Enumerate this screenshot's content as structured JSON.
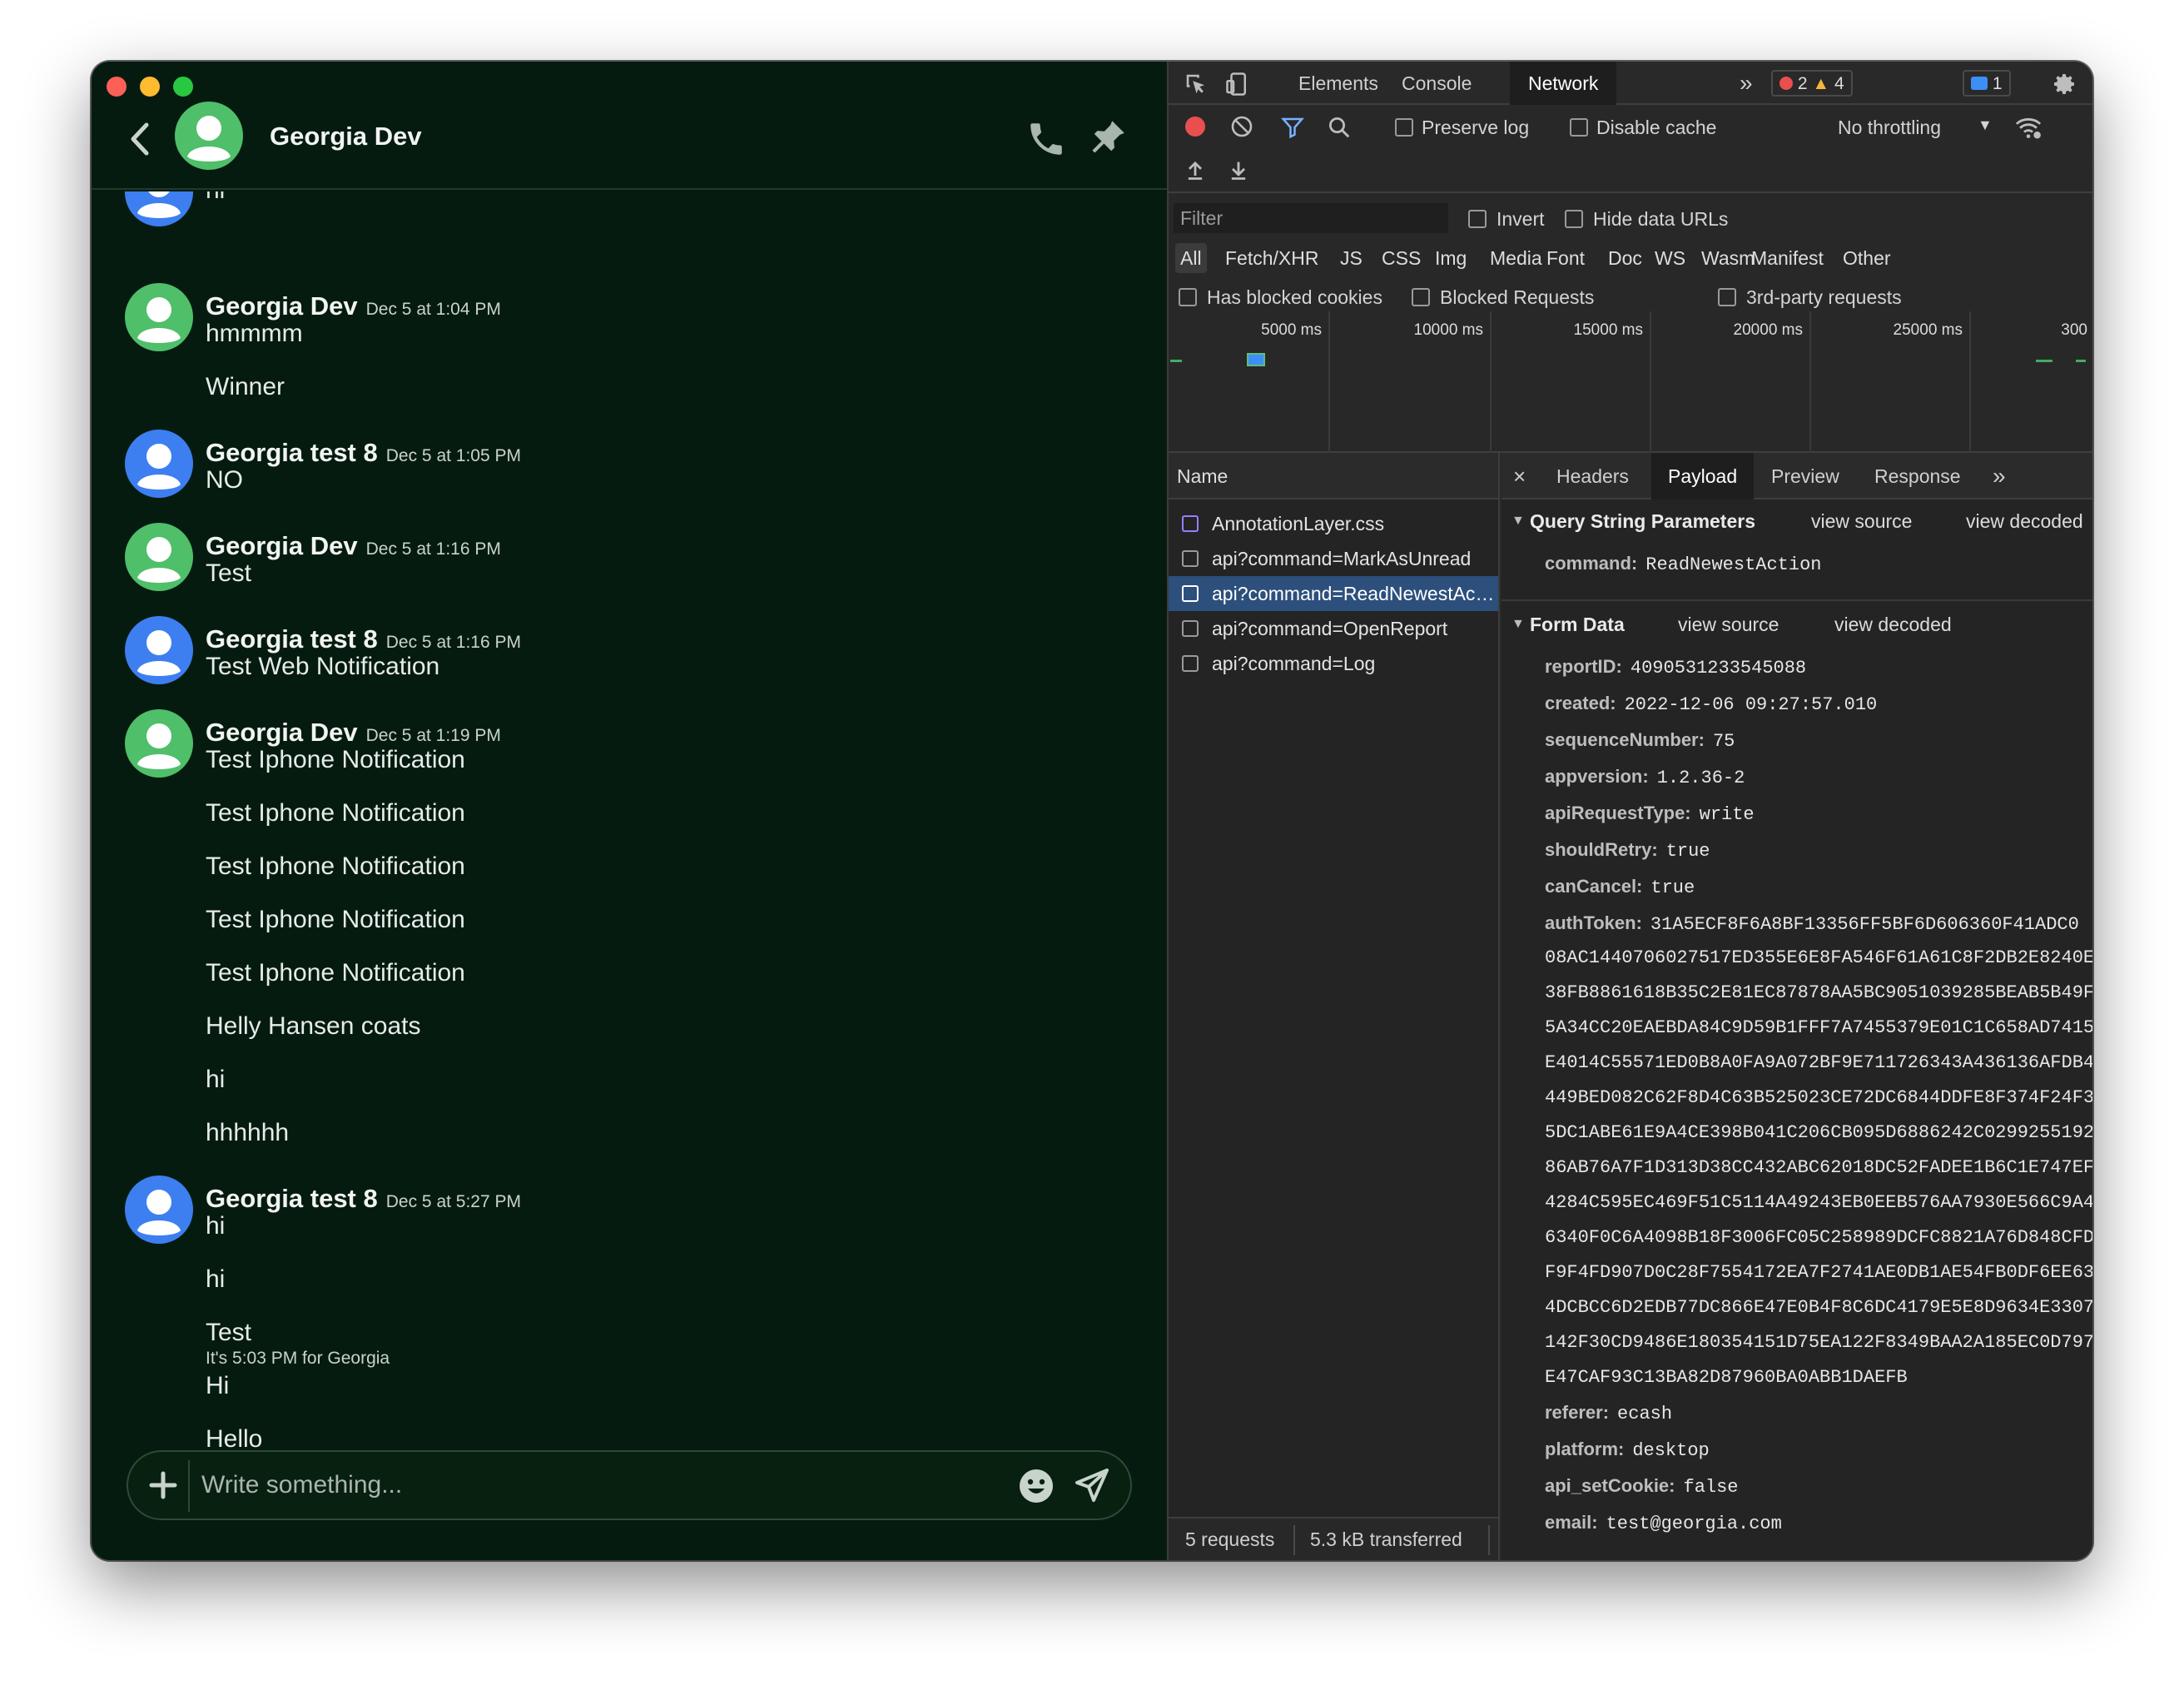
{
  "chat": {
    "contact_name": "Georgia Dev",
    "cut_text": "hi",
    "groups": [
      {
        "author": "Georgia Dev",
        "time": "Dec 5 at 1:04 PM",
        "color": "#4fbf6a",
        "lines": [
          "hmmmm",
          "Winner"
        ]
      },
      {
        "author": "Georgia test 8",
        "time": "Dec 5 at 1:05 PM",
        "color": "#3d7ff0",
        "lines": [
          "NO"
        ]
      },
      {
        "author": "Georgia Dev",
        "time": "Dec 5 at 1:16 PM",
        "color": "#4fbf6a",
        "lines": [
          "Test"
        ]
      },
      {
        "author": "Georgia test 8",
        "time": "Dec 5 at 1:16 PM",
        "color": "#3d7ff0",
        "lines": [
          "Test Web Notification"
        ]
      },
      {
        "author": "Georgia Dev",
        "time": "Dec 5 at 1:19 PM",
        "color": "#4fbf6a",
        "lines": [
          "Test Iphone Notification",
          "Test Iphone Notification",
          "Test Iphone Notification",
          "Test Iphone Notification",
          "Test Iphone Notification",
          "Helly Hansen coats",
          "hi",
          "hhhhhh"
        ]
      },
      {
        "author": "Georgia test 8",
        "time": "Dec 5 at 5:27 PM",
        "color": "#3d7ff0",
        "lines": [
          "hi",
          "hi",
          "Test",
          "Hi",
          "Hello"
        ]
      }
    ],
    "status_line": "It's 5:03 PM for Georgia",
    "composer_placeholder": "Write something..."
  },
  "devtools": {
    "tabs": {
      "elements": "Elements",
      "console": "Console",
      "network": "Network"
    },
    "badges": {
      "errors": "2",
      "warnings": "4",
      "messages": "1"
    },
    "toolbar": {
      "preserve_log": "Preserve log",
      "disable_cache": "Disable cache",
      "throttling": "No throttling"
    },
    "filter": {
      "placeholder": "Filter",
      "invert": "Invert",
      "hide_data_urls": "Hide data URLs",
      "types": [
        "All",
        "Fetch/XHR",
        "JS",
        "CSS",
        "Img",
        "Media",
        "Font",
        "Doc",
        "WS",
        "Wasm",
        "Manifest",
        "Other"
      ],
      "has_blocked_cookies": "Has blocked cookies",
      "blocked_requests": "Blocked Requests",
      "third_party": "3rd-party requests"
    },
    "timeline_labels": [
      "5000 ms",
      "10000 ms",
      "15000 ms",
      "20000 ms",
      "25000 ms",
      "300"
    ],
    "list": {
      "header": "Name",
      "requests": [
        {
          "name": "AnnotationLayer.css",
          "selected": false
        },
        {
          "name": "api?command=MarkAsUnread",
          "selected": false
        },
        {
          "name": "api?command=ReadNewestAction",
          "selected": true
        },
        {
          "name": "api?command=OpenReport",
          "selected": false
        },
        {
          "name": "api?command=Log",
          "selected": false
        }
      ],
      "summary_requests": "5 requests",
      "summary_transferred": "5.3 kB transferred"
    },
    "detail": {
      "tabs": [
        "Headers",
        "Payload",
        "Preview",
        "Response"
      ],
      "active_tab": "Payload",
      "query_section": {
        "title": "Query String Parameters",
        "view_source": "view source",
        "view_decoded": "view decoded",
        "params": [
          {
            "key": "command:",
            "value": "ReadNewestAction"
          }
        ]
      },
      "form_section": {
        "title": "Form Data",
        "view_source": "view source",
        "view_decoded": "view decoded",
        "fields_before": [
          {
            "key": "reportID:",
            "value": "4090531233545088"
          },
          {
            "key": "created:",
            "value": "2022-12-06 09:27:57.010"
          },
          {
            "key": "sequenceNumber:",
            "value": "75"
          },
          {
            "key": "appversion:",
            "value": "1.2.36-2"
          },
          {
            "key": "apiRequestType:",
            "value": "write"
          },
          {
            "key": "shouldRetry:",
            "value": "true"
          },
          {
            "key": "canCancel:",
            "value": "true"
          }
        ],
        "auth_key": "authToken:",
        "auth_lines": [
          "31A5ECF8F6A8BF13356FF5BF6D606360F41ADC0",
          "08AC1440706027517ED355E6E8FA546F61A61C8F2DB2E8240E",
          "38FB8861618B35C2E81EC87878AA5BC9051039285BEAB5B49F",
          "5A34CC20EAEBDA84C9D59B1FFF7A7455379E01C1C658AD7415",
          "E4014C55571ED0B8A0FA9A072BF9E711726343A436136AFDB4",
          "449BED082C62F8D4C63B525023CE72DC6844DDFE8F374F24F3",
          "5DC1ABE61E9A4CE398B041C206CB095D6886242C0299255192",
          "86AB76A7F1D313D38CC432ABC62018DC52FADEE1B6C1E747EF",
          "4284C595EC469F51C5114A49243EB0EEB576AA7930E566C9A4",
          "6340F0C6A4098B18F3006FC05C258989DCFC8821A76D848CFD",
          "F9F4FD907D0C28F7554172EA7F2741AE0DB1AE54FB0DF6EE63",
          "4DCBCC6D2EDB77DC866E47E0B4F8C6DC4179E5E8D9634E3307",
          "142F30CD9486E180354151D75EA122F8349BAA2A185EC0D797",
          "E47CAF93C13BA82D87960BA0ABB1DAEFB"
        ],
        "fields_after": [
          {
            "key": "referer:",
            "value": "ecash"
          },
          {
            "key": "platform:",
            "value": "desktop"
          },
          {
            "key": "api_setCookie:",
            "value": "false"
          },
          {
            "key": "email:",
            "value": "test@georgia.com"
          }
        ]
      }
    }
  }
}
